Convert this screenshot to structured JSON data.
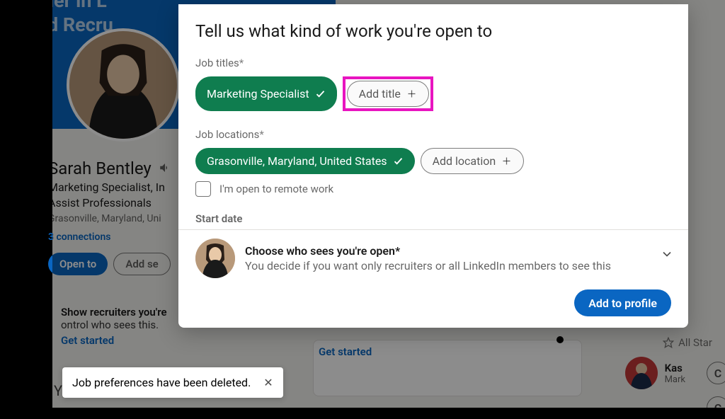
{
  "background": {
    "banner": "The Leader in L\nSales and Recru",
    "profile": {
      "name": "Sarah Bentley",
      "title": "Marketing Specialist, In\nAssist Professionals",
      "location": "Grasonville, Maryland, Uni",
      "connections": "3 connections",
      "open_to": "Open to",
      "add_section": "Add se"
    },
    "promo": {
      "line1": "Show recruiters you're",
      "line2": "ontrol who sees this.",
      "get_started": "Get started"
    },
    "get_started2": "Get started",
    "dashboard": "Your Dashboard",
    "all_star": "All Star",
    "person": {
      "name": "Kas",
      "sub": "Mark"
    },
    "c_btn": "C"
  },
  "toast": {
    "text": "Job preferences have been deleted."
  },
  "modal": {
    "heading": "Tell us what kind of work you're open to",
    "job_titles_label": "Job titles",
    "titles": {
      "selected": "Marketing Specialist",
      "add": "Add title"
    },
    "job_locations_label": "Job locations",
    "locations": {
      "selected": "Grasonville, Maryland, United States",
      "add": "Add location"
    },
    "remote_label": "I'm open to remote work",
    "start_date_label": "Start date",
    "visibility": {
      "title": "Choose who sees you're open*",
      "desc": "You decide if you want only recruiters or all LinkedIn members to see this"
    },
    "submit": "Add to profile"
  }
}
